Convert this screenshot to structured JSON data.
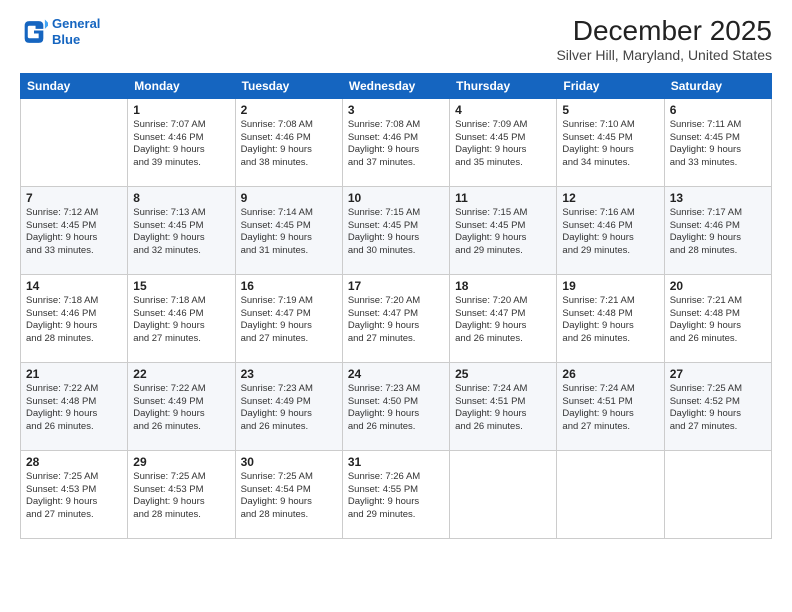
{
  "logo": {
    "line1": "General",
    "line2": "Blue"
  },
  "title": "December 2025",
  "subtitle": "Silver Hill, Maryland, United States",
  "days_of_week": [
    "Sunday",
    "Monday",
    "Tuesday",
    "Wednesday",
    "Thursday",
    "Friday",
    "Saturday"
  ],
  "weeks": [
    [
      {
        "day": "",
        "info": ""
      },
      {
        "day": "1",
        "info": "Sunrise: 7:07 AM\nSunset: 4:46 PM\nDaylight: 9 hours\nand 39 minutes."
      },
      {
        "day": "2",
        "info": "Sunrise: 7:08 AM\nSunset: 4:46 PM\nDaylight: 9 hours\nand 38 minutes."
      },
      {
        "day": "3",
        "info": "Sunrise: 7:08 AM\nSunset: 4:46 PM\nDaylight: 9 hours\nand 37 minutes."
      },
      {
        "day": "4",
        "info": "Sunrise: 7:09 AM\nSunset: 4:45 PM\nDaylight: 9 hours\nand 35 minutes."
      },
      {
        "day": "5",
        "info": "Sunrise: 7:10 AM\nSunset: 4:45 PM\nDaylight: 9 hours\nand 34 minutes."
      },
      {
        "day": "6",
        "info": "Sunrise: 7:11 AM\nSunset: 4:45 PM\nDaylight: 9 hours\nand 33 minutes."
      }
    ],
    [
      {
        "day": "7",
        "info": "Sunrise: 7:12 AM\nSunset: 4:45 PM\nDaylight: 9 hours\nand 33 minutes."
      },
      {
        "day": "8",
        "info": "Sunrise: 7:13 AM\nSunset: 4:45 PM\nDaylight: 9 hours\nand 32 minutes."
      },
      {
        "day": "9",
        "info": "Sunrise: 7:14 AM\nSunset: 4:45 PM\nDaylight: 9 hours\nand 31 minutes."
      },
      {
        "day": "10",
        "info": "Sunrise: 7:15 AM\nSunset: 4:45 PM\nDaylight: 9 hours\nand 30 minutes."
      },
      {
        "day": "11",
        "info": "Sunrise: 7:15 AM\nSunset: 4:45 PM\nDaylight: 9 hours\nand 29 minutes."
      },
      {
        "day": "12",
        "info": "Sunrise: 7:16 AM\nSunset: 4:46 PM\nDaylight: 9 hours\nand 29 minutes."
      },
      {
        "day": "13",
        "info": "Sunrise: 7:17 AM\nSunset: 4:46 PM\nDaylight: 9 hours\nand 28 minutes."
      }
    ],
    [
      {
        "day": "14",
        "info": "Sunrise: 7:18 AM\nSunset: 4:46 PM\nDaylight: 9 hours\nand 28 minutes."
      },
      {
        "day": "15",
        "info": "Sunrise: 7:18 AM\nSunset: 4:46 PM\nDaylight: 9 hours\nand 27 minutes."
      },
      {
        "day": "16",
        "info": "Sunrise: 7:19 AM\nSunset: 4:47 PM\nDaylight: 9 hours\nand 27 minutes."
      },
      {
        "day": "17",
        "info": "Sunrise: 7:20 AM\nSunset: 4:47 PM\nDaylight: 9 hours\nand 27 minutes."
      },
      {
        "day": "18",
        "info": "Sunrise: 7:20 AM\nSunset: 4:47 PM\nDaylight: 9 hours\nand 26 minutes."
      },
      {
        "day": "19",
        "info": "Sunrise: 7:21 AM\nSunset: 4:48 PM\nDaylight: 9 hours\nand 26 minutes."
      },
      {
        "day": "20",
        "info": "Sunrise: 7:21 AM\nSunset: 4:48 PM\nDaylight: 9 hours\nand 26 minutes."
      }
    ],
    [
      {
        "day": "21",
        "info": "Sunrise: 7:22 AM\nSunset: 4:48 PM\nDaylight: 9 hours\nand 26 minutes."
      },
      {
        "day": "22",
        "info": "Sunrise: 7:22 AM\nSunset: 4:49 PM\nDaylight: 9 hours\nand 26 minutes."
      },
      {
        "day": "23",
        "info": "Sunrise: 7:23 AM\nSunset: 4:49 PM\nDaylight: 9 hours\nand 26 minutes."
      },
      {
        "day": "24",
        "info": "Sunrise: 7:23 AM\nSunset: 4:50 PM\nDaylight: 9 hours\nand 26 minutes."
      },
      {
        "day": "25",
        "info": "Sunrise: 7:24 AM\nSunset: 4:51 PM\nDaylight: 9 hours\nand 26 minutes."
      },
      {
        "day": "26",
        "info": "Sunrise: 7:24 AM\nSunset: 4:51 PM\nDaylight: 9 hours\nand 27 minutes."
      },
      {
        "day": "27",
        "info": "Sunrise: 7:25 AM\nSunset: 4:52 PM\nDaylight: 9 hours\nand 27 minutes."
      }
    ],
    [
      {
        "day": "28",
        "info": "Sunrise: 7:25 AM\nSunset: 4:53 PM\nDaylight: 9 hours\nand 27 minutes."
      },
      {
        "day": "29",
        "info": "Sunrise: 7:25 AM\nSunset: 4:53 PM\nDaylight: 9 hours\nand 28 minutes."
      },
      {
        "day": "30",
        "info": "Sunrise: 7:25 AM\nSunset: 4:54 PM\nDaylight: 9 hours\nand 28 minutes."
      },
      {
        "day": "31",
        "info": "Sunrise: 7:26 AM\nSunset: 4:55 PM\nDaylight: 9 hours\nand 29 minutes."
      },
      {
        "day": "",
        "info": ""
      },
      {
        "day": "",
        "info": ""
      },
      {
        "day": "",
        "info": ""
      }
    ]
  ]
}
